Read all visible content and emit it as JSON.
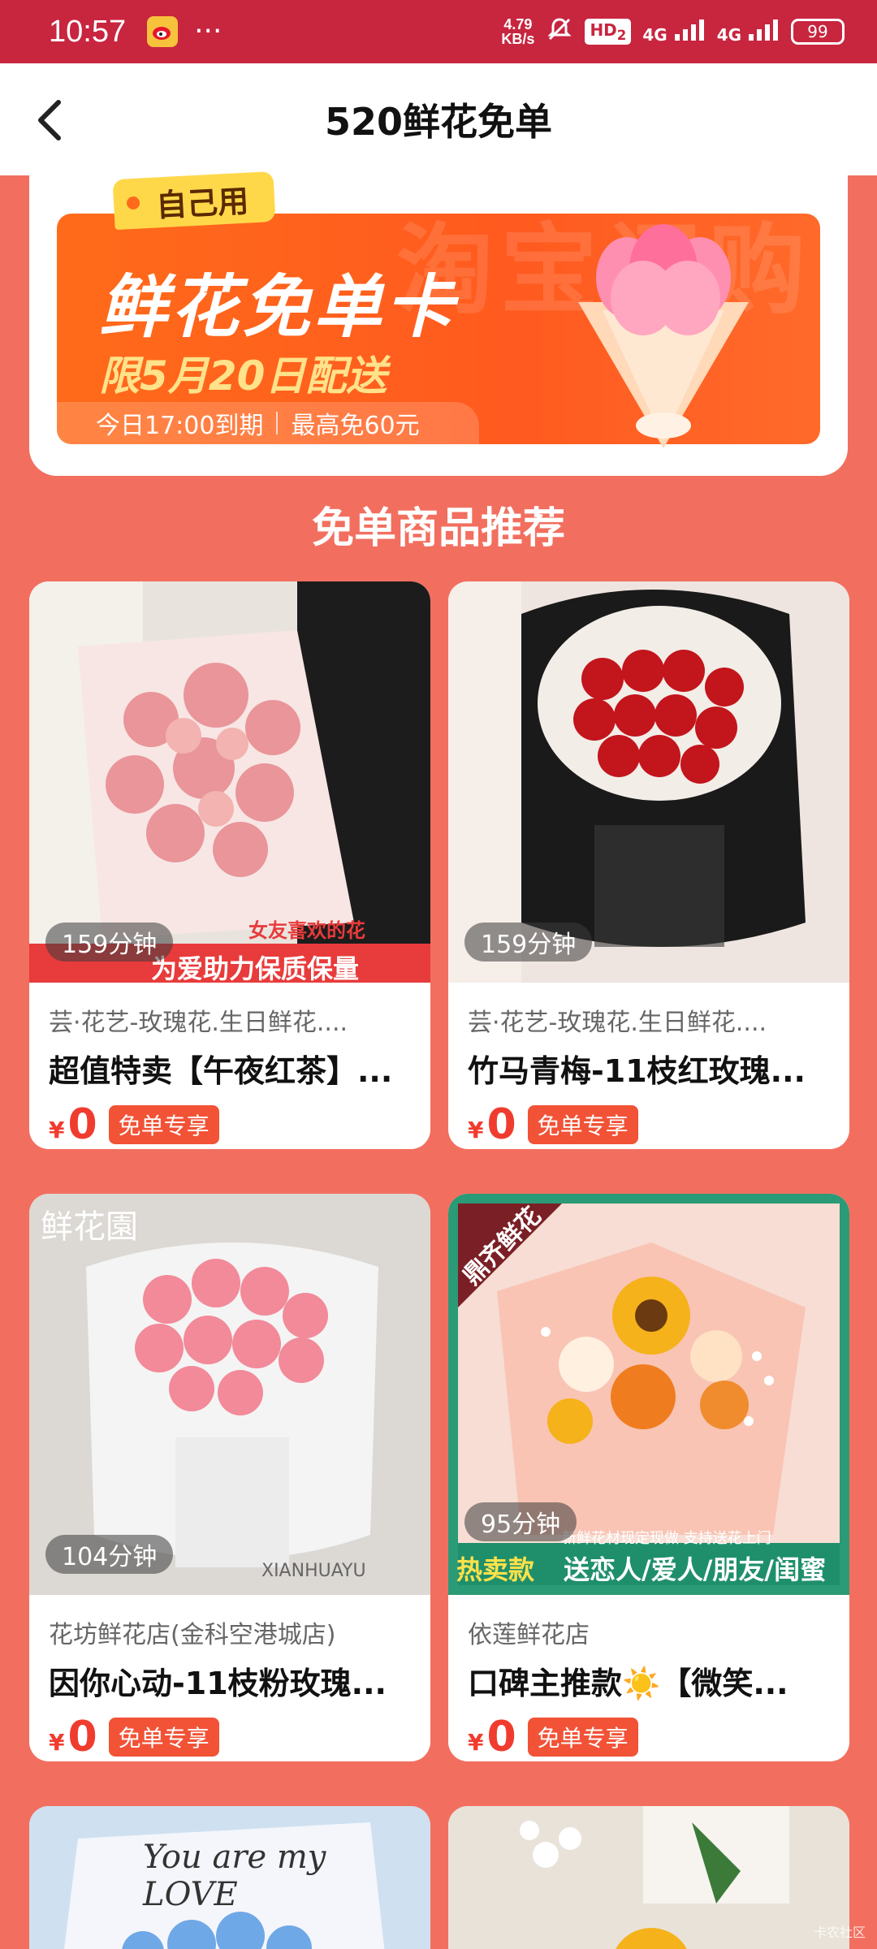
{
  "status_bar": {
    "time": "10:57",
    "dots": "···",
    "net_speed_value": "4.79",
    "net_speed_unit": "KB/s",
    "hd": "HD",
    "hd_sub": "2",
    "sig1": "4G",
    "sig2": "4G",
    "battery": "99"
  },
  "header": {
    "title": "520鲜花免单"
  },
  "coupon": {
    "tag": "自己用",
    "title": "鲜花免单卡",
    "subtitle": "限5月20日配送",
    "expire": "今日17:00到期",
    "max_free": "最高免60元",
    "watermark": "淘宝闪购"
  },
  "section": {
    "title": "免单商品推荐"
  },
  "products": [
    {
      "time": "159分钟",
      "shop": "芸·花艺-玫瑰花.生日鲜花....",
      "name": "超值特卖【午夜红茶】...",
      "yen": "¥",
      "price": "0",
      "badge": "免单专享",
      "banner": "为爱助力保质保量",
      "banner_top": "女友喜欢的花"
    },
    {
      "time": "159分钟",
      "shop": "芸·花艺-玫瑰花.生日鲜花....",
      "name": "竹马青梅-11枝红玫瑰...",
      "yen": "¥",
      "price": "0",
      "badge": "免单专享"
    },
    {
      "time": "104分钟",
      "shop": "花坊鲜花店(金科空港城店)",
      "name": "因你心动-11枝粉玫瑰...",
      "yen": "¥",
      "price": "0",
      "badge": "免单专享",
      "logo": "鲜花園",
      "logo_en": "XIANHUAYU"
    },
    {
      "time": "95分钟",
      "shop": "依莲鲜花店",
      "name": "口碑主推款☀️【微笑...",
      "yen": "¥",
      "price": "0",
      "badge": "免单专享",
      "ribbon": "鼎齐鲜花",
      "banner": "送恋人/爱人/朋友/闺蜜",
      "banner_small": "新鲜花材现定现做 支持送花上门",
      "banner_left": "热卖款"
    },
    {
      "time": "",
      "shop": "",
      "name": "",
      "image_text": "You are my LOVE"
    },
    {
      "time": "",
      "shop": "",
      "name": ""
    }
  ],
  "footer_watermark": "卡农社区",
  "colors": {
    "accent": "#f03c2e",
    "page_bg": "#f26f5f",
    "status_bar": "#c8253f",
    "coupon": "#ff5a1f"
  }
}
